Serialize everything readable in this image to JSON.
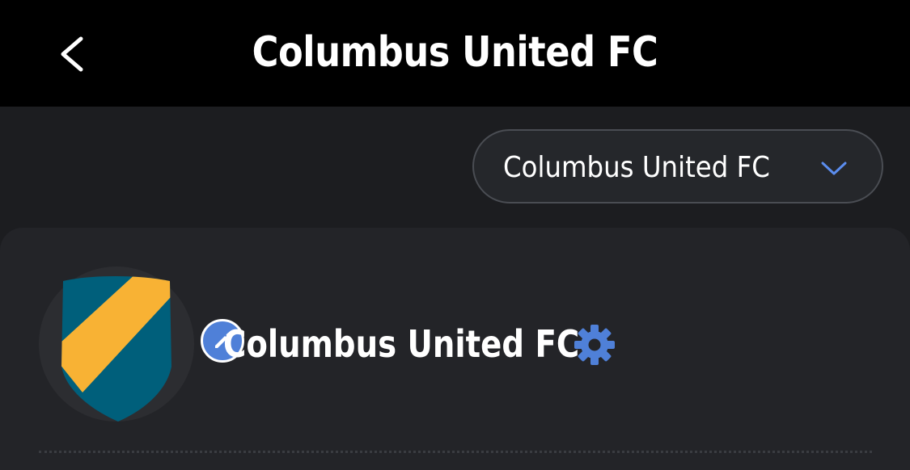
{
  "header": {
    "title": "Columbus United FC",
    "back_icon": "chevron-left-icon"
  },
  "team_selector": {
    "selected": "Columbus United FC",
    "icon": "chevron-down-icon",
    "chevron_color": "#5b8def"
  },
  "team_card": {
    "name": "Columbus United FC",
    "crest_icon": "shield-crest-icon",
    "crest_colors": {
      "primary": "#005f7b",
      "stripe": "#f8b234"
    },
    "edit_icon": "pencil-icon",
    "edit_badge_color": "#4f80d8",
    "settings_icon": "gear-icon",
    "settings_color": "#4f80d8"
  }
}
